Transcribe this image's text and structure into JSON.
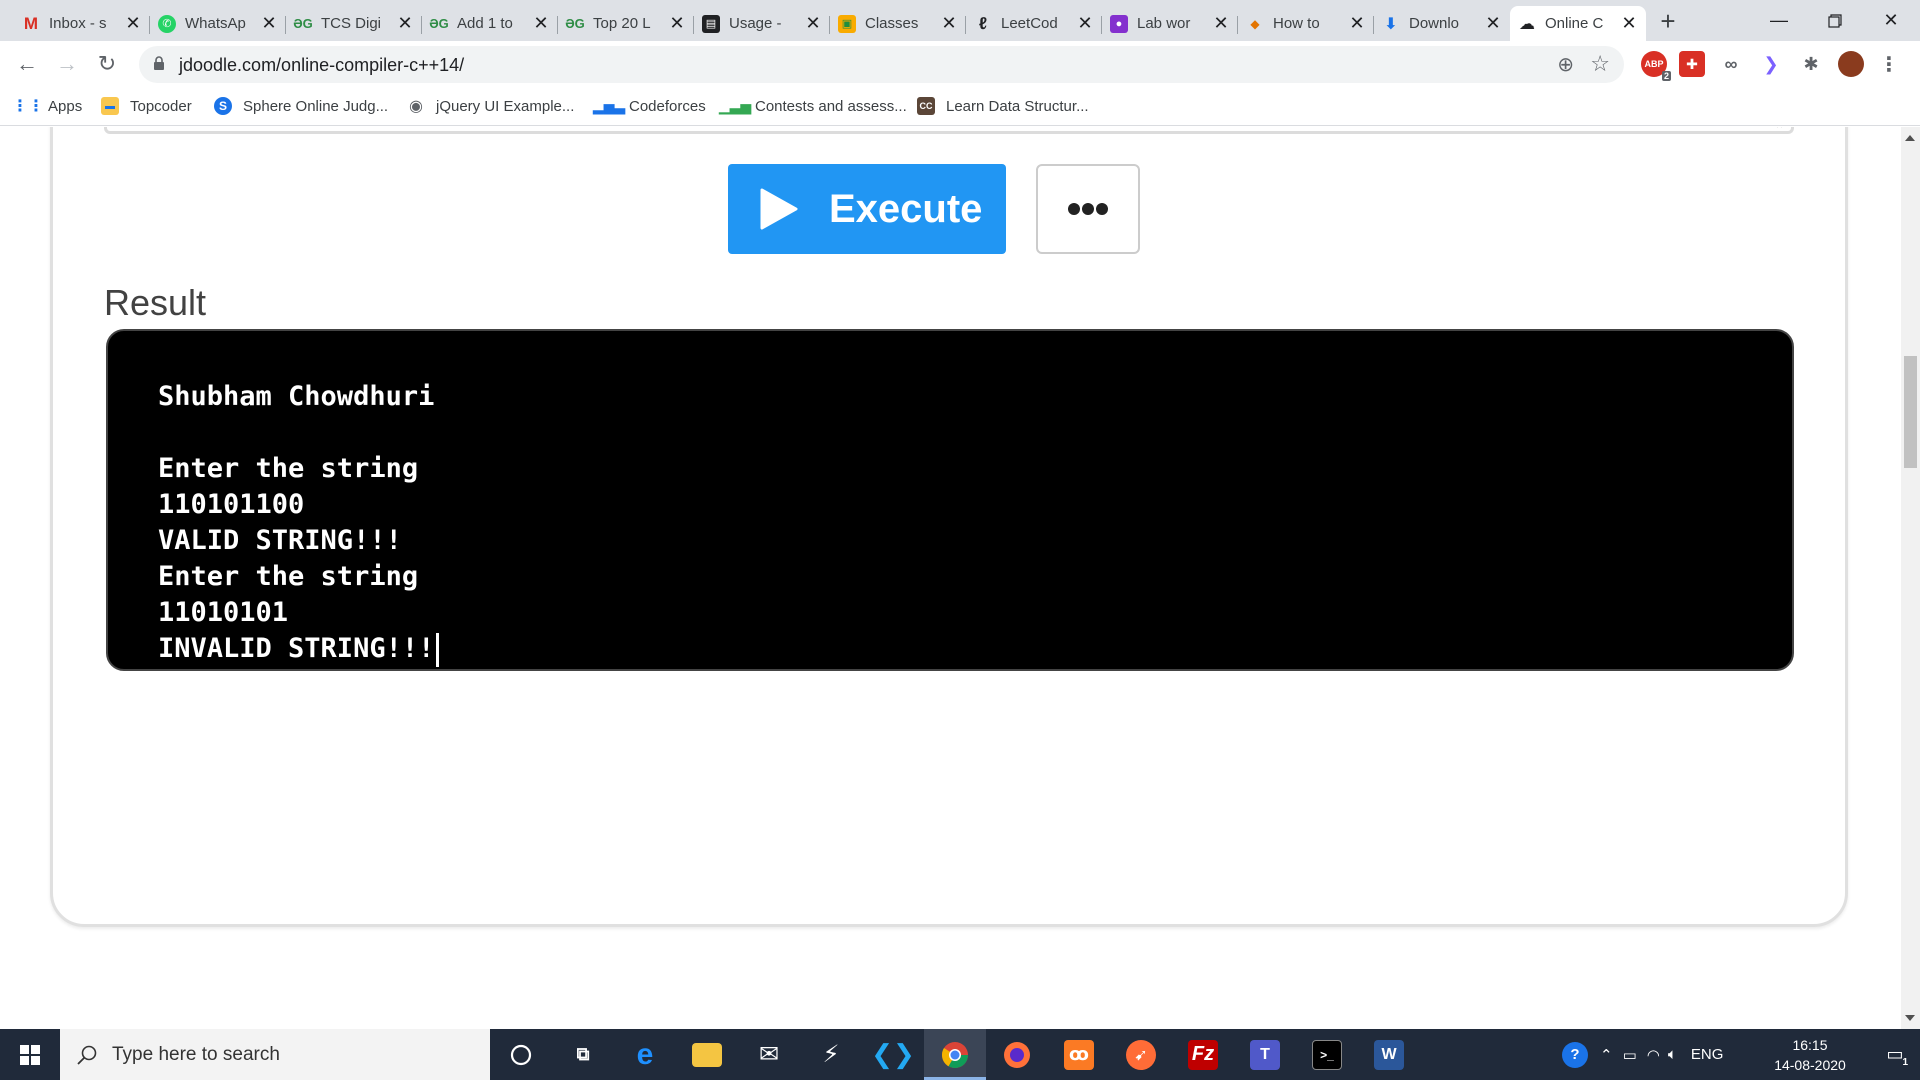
{
  "browser": {
    "tabs": [
      {
        "title": "Inbox - s",
        "favicon": "gmail-icon",
        "active": false
      },
      {
        "title": "WhatsAp",
        "favicon": "whatsapp-icon",
        "active": false
      },
      {
        "title": "TCS Digi",
        "favicon": "geeksforgeeks-icon",
        "active": false
      },
      {
        "title": "Add 1 to",
        "favicon": "geeksforgeeks-icon",
        "active": false
      },
      {
        "title": "Top 20 L",
        "favicon": "geeksforgeeks-icon",
        "active": false
      },
      {
        "title": "Usage -",
        "favicon": "book-icon",
        "active": false
      },
      {
        "title": "Classes",
        "favicon": "google-classroom-icon",
        "active": false
      },
      {
        "title": "LeetCod",
        "favicon": "leetcode-icon",
        "active": false
      },
      {
        "title": "Lab wor",
        "favicon": "user-icon",
        "active": false
      },
      {
        "title": "How to",
        "favicon": "page-icon",
        "active": false
      },
      {
        "title": "Downlo",
        "favicon": "download-icon",
        "active": false
      },
      {
        "title": "Online C",
        "favicon": "jdoodle-icon",
        "active": true
      }
    ],
    "url": "jdoodle.com/online-compiler-c++14/",
    "extension_badge": "2",
    "bookmarks": [
      {
        "label": "Apps",
        "icon": "apps-grid-icon"
      },
      {
        "label": "Topcoder",
        "icon": "folder-icon"
      },
      {
        "label": "Sphere Online Judg...",
        "icon": "spoj-icon"
      },
      {
        "label": "jQuery UI Example...",
        "icon": "globe-icon"
      },
      {
        "label": "Codeforces",
        "icon": "codeforces-icon"
      },
      {
        "label": "Contests and assess...",
        "icon": "hackerearth-icon"
      },
      {
        "label": "Learn Data Structur...",
        "icon": "codechef-icon"
      }
    ]
  },
  "page": {
    "execute_label": "Execute",
    "result_heading": "Result",
    "output_lines": [
      "Shubham Chowdhuri",
      "",
      "Enter the string",
      "110101100",
      "VALID STRING!!!",
      "Enter the string",
      "11010101",
      "INVALID STRING!!!"
    ]
  },
  "taskbar": {
    "search_placeholder": "Type here to search",
    "apps": [
      "cortana-icon",
      "task-view-icon",
      "edge-icon",
      "file-explorer-icon",
      "mail-icon",
      "onedrive-icon",
      "vscode-icon",
      "chrome-icon",
      "firefox-icon",
      "xampp-icon",
      "postman-icon",
      "filezilla-icon",
      "teams-icon",
      "terminal-icon",
      "word-icon"
    ],
    "language": "ENG",
    "time": "16:15",
    "date": "14-08-2020",
    "notification_count": "1"
  },
  "colors": {
    "execute_button": "#2196f3",
    "result_background": "#000000",
    "result_text": "#ffffff",
    "taskbar": "#202a3a"
  }
}
